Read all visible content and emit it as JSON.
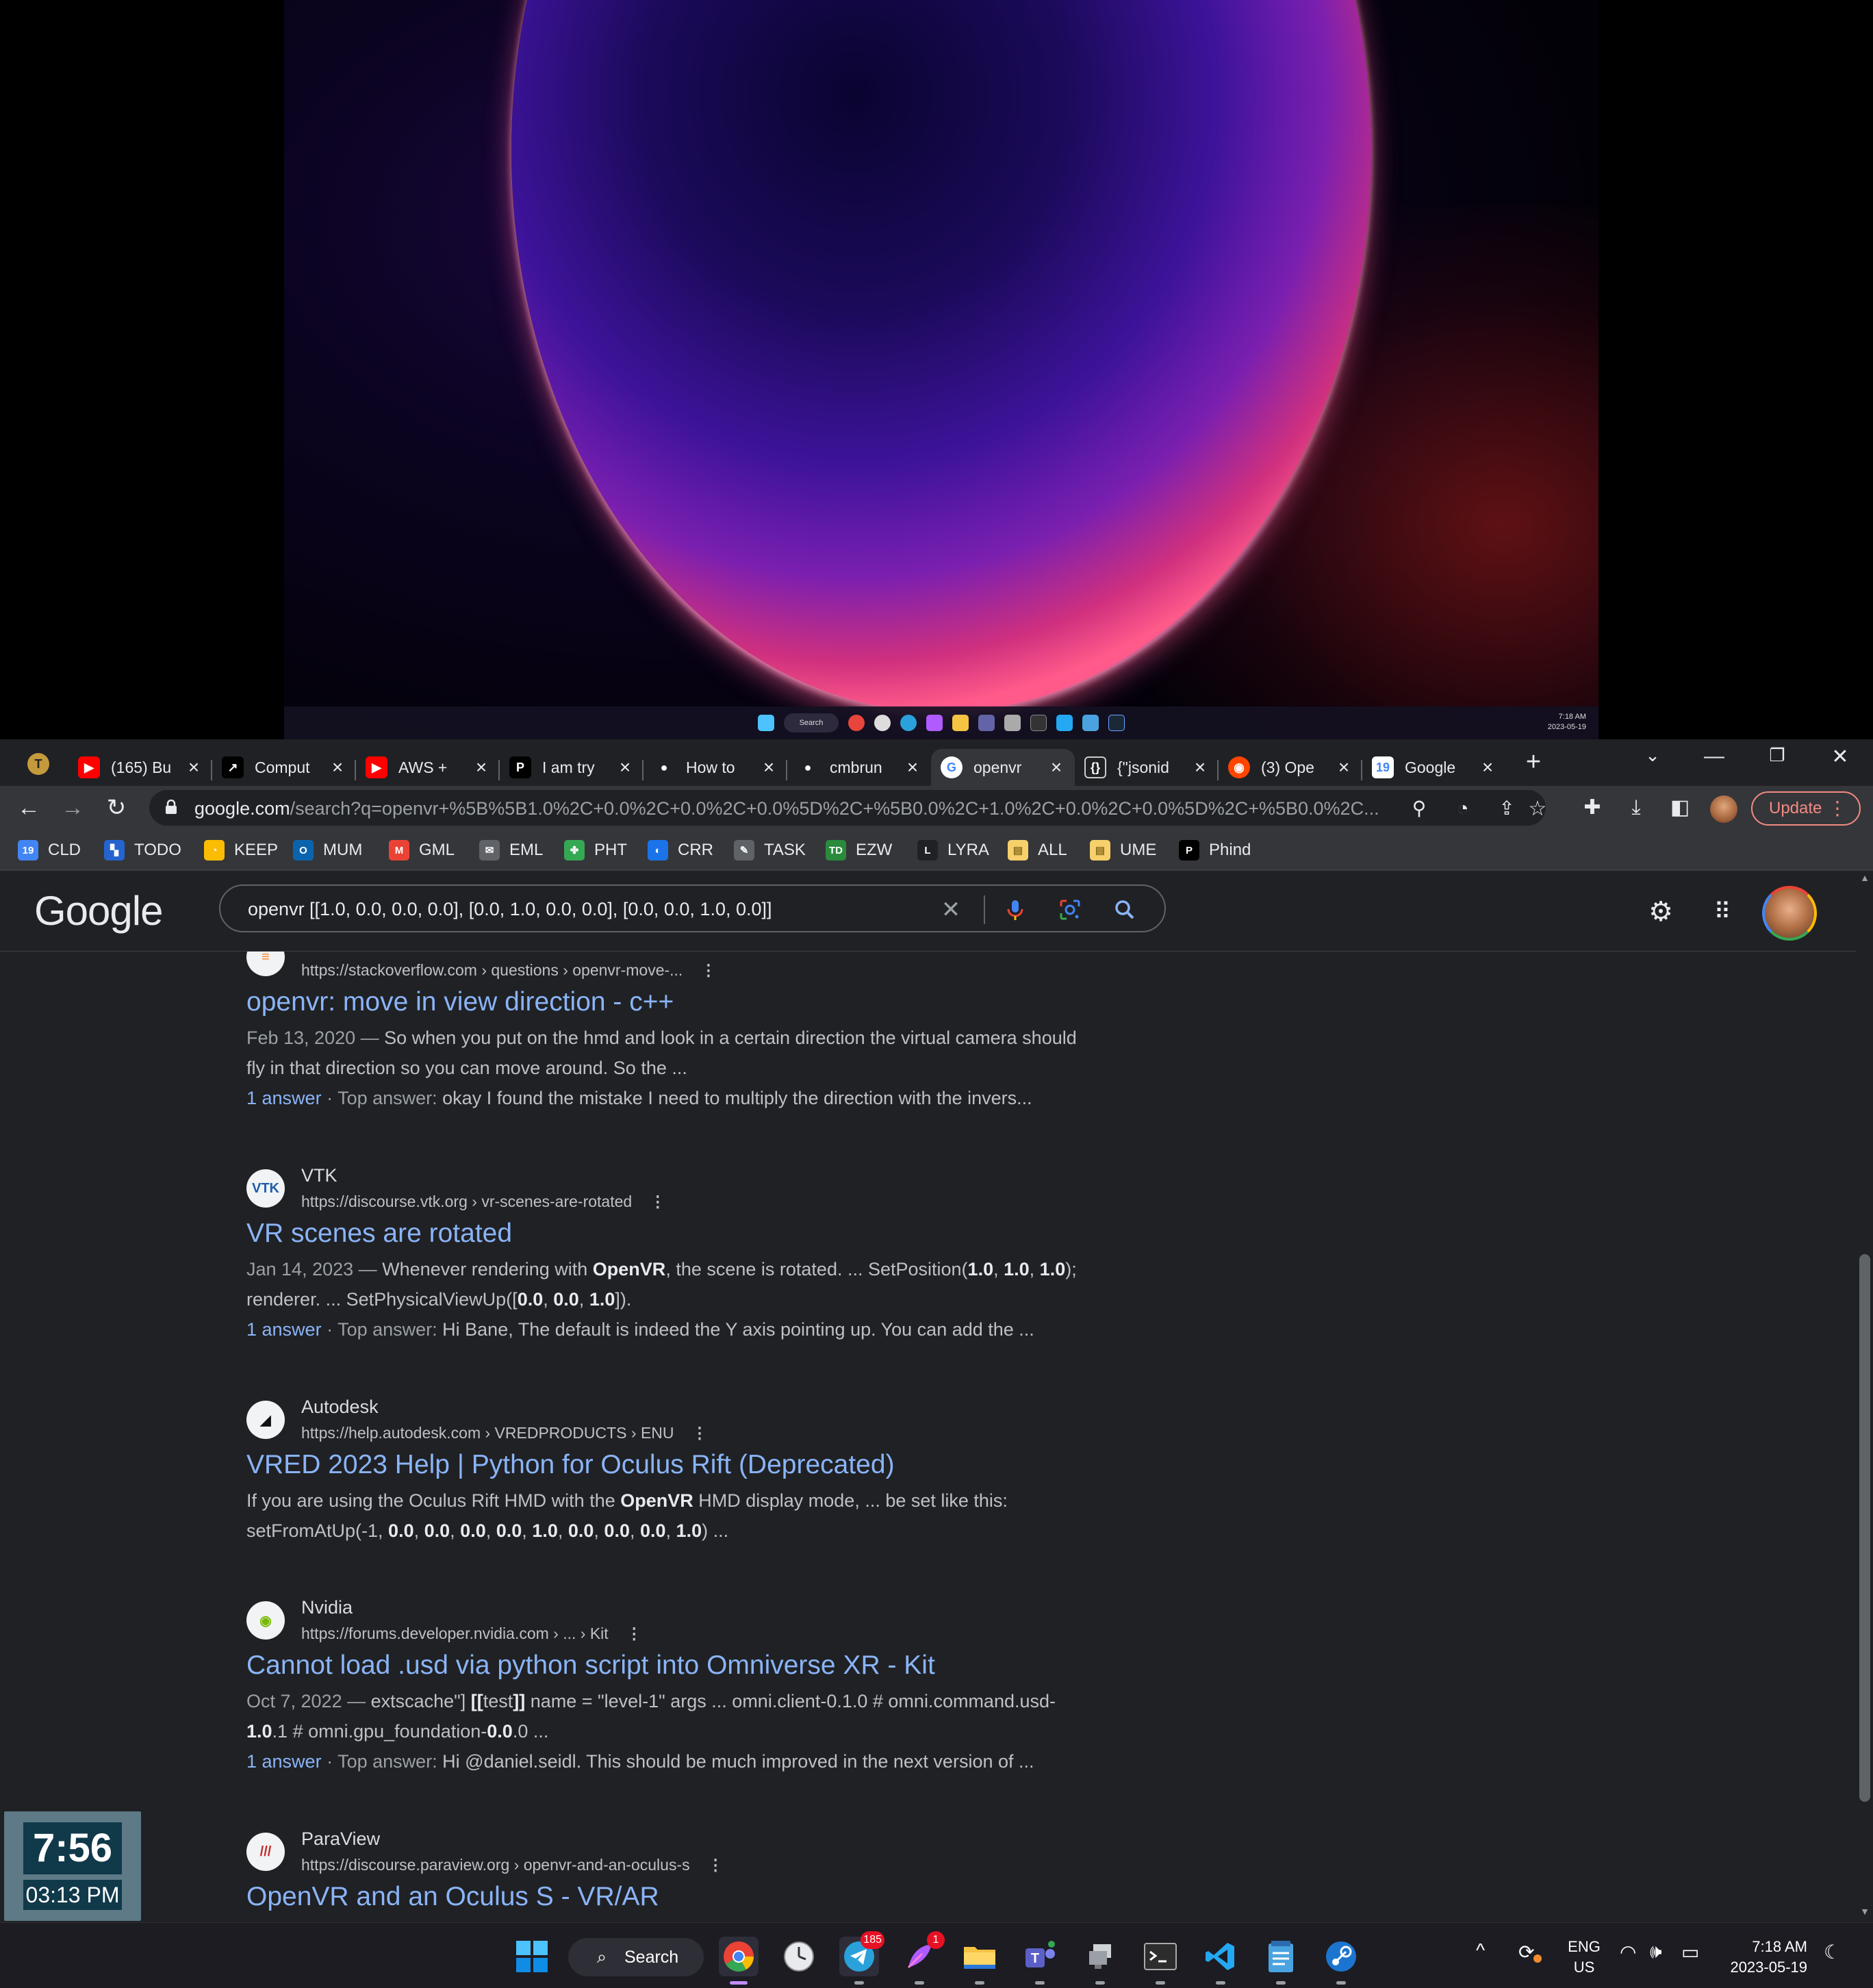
{
  "upper_monitor": {
    "mini_taskbar": {
      "search_label": "Search",
      "time": "7:18 AM",
      "date": "2023-05-19"
    }
  },
  "browser": {
    "profile_letter": "T",
    "tabs": [
      {
        "label": "(165) Bu",
        "icon": "youtube-icon",
        "color": "#ff0000"
      },
      {
        "label": "Comput",
        "icon": "arrow-logo-icon",
        "color": "#111111"
      },
      {
        "label": "AWS +",
        "icon": "youtube-icon",
        "color": "#ff0000"
      },
      {
        "label": "I am try",
        "icon": "p-logo-icon",
        "color": "#000000"
      },
      {
        "label": "How to",
        "icon": "github-icon",
        "color": "#ffffff"
      },
      {
        "label": "cmbrun",
        "icon": "github-icon",
        "color": "#ffffff"
      },
      {
        "label": "openvr",
        "icon": "google-icon",
        "color": "#4285f4"
      },
      {
        "label": "{\"jsonid",
        "icon": "json-icon",
        "color": "#ffffff"
      },
      {
        "label": "(3) Ope",
        "icon": "reddit-icon",
        "color": "#ff4500"
      },
      {
        "label": "Google",
        "icon": "google-calendar-icon",
        "color": "#4285f4"
      }
    ],
    "new_tab_symbol": "+",
    "window_controls": {
      "minimize": "—",
      "restore": "❐",
      "close": "✕"
    },
    "url_host": "google.com",
    "url_rest": "/search?q=openvr+%5B%5B1.0%2C+0.0%2C+0.0%2C+0.0%5D%2C+%5B0.0%2C+1.0%2C+0.0%2C+0.0%5D%2C+%5B0.0%2C...",
    "update_label": "Update",
    "bookmarks": [
      {
        "label": "CLD",
        "icon": "google-calendar-icon",
        "color": "#4285f4",
        "glyph": "19"
      },
      {
        "label": "TODO",
        "icon": "todo-icon",
        "color": "#2564cf",
        "glyph": "▚"
      },
      {
        "label": "KEEP",
        "icon": "keep-icon",
        "color": "#fbbc04",
        "glyph": "◔"
      },
      {
        "label": "MUM",
        "icon": "outlook-icon",
        "color": "#0a64ad",
        "glyph": "O"
      },
      {
        "label": "GML",
        "icon": "gmail-icon",
        "color": "#ea4335",
        "glyph": "M"
      },
      {
        "label": "EML",
        "icon": "mail-icon",
        "color": "#5f6368",
        "glyph": "✉"
      },
      {
        "label": "PHT",
        "icon": "photos-icon",
        "color": "#34a853",
        "glyph": "✤"
      },
      {
        "label": "CRR",
        "icon": "refresh-logo-icon",
        "color": "#1a73e8",
        "glyph": "◐"
      },
      {
        "label": "TASK",
        "icon": "task-icon",
        "color": "#5f6368",
        "glyph": "✎"
      },
      {
        "label": "EZW",
        "icon": "td-icon",
        "color": "#2a8b3d",
        "glyph": "TD"
      },
      {
        "label": "LYRA",
        "icon": "lyra-icon",
        "color": "#202124",
        "glyph": "L"
      },
      {
        "label": "ALL",
        "icon": "folder-icon",
        "color": "#f6d06b",
        "glyph": "▤"
      },
      {
        "label": "UME",
        "icon": "folder-icon",
        "color": "#f6d06b",
        "glyph": "▤"
      },
      {
        "label": "Phind",
        "icon": "phind-icon",
        "color": "#000000",
        "glyph": "P"
      }
    ]
  },
  "google": {
    "logo": "Google",
    "query": "openvr [[1.0, 0.0, 0.0, 0.0], [0.0, 1.0, 0.0, 0.0], [0.0, 0.0, 1.0, 0.0]]",
    "results": [
      {
        "site": "",
        "url": "https://stackoverflow.com › questions › openvr-move-...",
        "title": "openvr: move in view direction - c++",
        "snippet_html": "<span class=\"date\">Feb 13, 2020 — </span>So when you put on the hmd and look in a certain direction the virtual camera should fly in that direction so you can move around. So the ...",
        "answer_count": "1 answer",
        "answer_label": " · Top answer: ",
        "answer_text": "okay I found the mistake I need to multiply the direction with the invers...",
        "icon": "stackoverflow-icon",
        "glyph": "≡",
        "color": "#f48024"
      },
      {
        "site": "VTK",
        "url": "https://discourse.vtk.org › vr-scenes-are-rotated",
        "title": "VR scenes are rotated",
        "snippet_html": "<span class=\"date\">Jan 14, 2023 — </span>Whenever rendering with <b>OpenVR</b>, the scene is rotated. ... SetPosition(<b>1.0</b>, <b>1.0</b>, <b>1.0</b>); renderer. ... SetPhysicalViewUp([<b>0.0</b>, <b>0.0</b>, <b>1.0</b>]).",
        "answer_count": "1 answer",
        "answer_label": " · Top answer: ",
        "answer_text": "Hi Bane, The default is indeed the Y axis pointing up. You can add the ...",
        "icon": "vtk-icon",
        "glyph": "VTK",
        "color": "#1f5ea8"
      },
      {
        "site": "Autodesk",
        "url": "https://help.autodesk.com › VREDPRODUCTS › ENU",
        "title": "VRED 2023 Help | Python for Oculus Rift (Deprecated)",
        "snippet_html": "If you are using the Oculus Rift HMD with the <b>OpenVR</b> HMD display mode, ... be set like this: setFromAtUp(-1, <b>0.0</b>, <b>0.0</b>, <b>0.0</b>, <b>0.0</b>, <b>1.0</b>, <b>0.0</b>, <b>0.0</b>, <b>0.0</b>, <b>1.0</b>) ...",
        "answer_count": "",
        "answer_label": "",
        "answer_text": "",
        "icon": "autodesk-icon",
        "glyph": "◢",
        "color": "#111111"
      },
      {
        "site": "Nvidia",
        "url": "https://forums.developer.nvidia.com › ... › Kit",
        "title": "Cannot load .usd via python script into Omniverse XR - Kit",
        "snippet_html": "<span class=\"date\">Oct 7, 2022 — </span>extscache\"] <b>[[</b>test<b>]]</b> name = \"level-1\" args ... omni.client-0.1.0 # omni.command.usd-<b>1.0</b>.1 # omni.gpu_foundation-<b>0.0</b>.0 ...",
        "answer_count": "1 answer",
        "answer_label": " · Top answer: ",
        "answer_text": "Hi @daniel.seidl. This should be much improved in the next version of ...",
        "icon": "nvidia-icon",
        "glyph": "◉",
        "color": "#76b900"
      },
      {
        "site": "ParaView",
        "url": "https://discourse.paraview.org › openvr-and-an-oculus-s",
        "title": "OpenVR and an Oculus S - VR/AR",
        "snippet_html": "",
        "answer_count": "",
        "answer_label": "",
        "answer_text": "",
        "icon": "paraview-icon",
        "glyph": "///",
        "color": "#c62828"
      }
    ]
  },
  "clock_widget": {
    "time_big": "7:56",
    "time_small": "03:13 PM"
  },
  "taskbar": {
    "search_label": "Search",
    "telegram_badge": "185",
    "app_badge": "1",
    "lang_line1": "ENG",
    "lang_line2": "US",
    "time": "7:18 AM",
    "date": "2023-05-19"
  }
}
